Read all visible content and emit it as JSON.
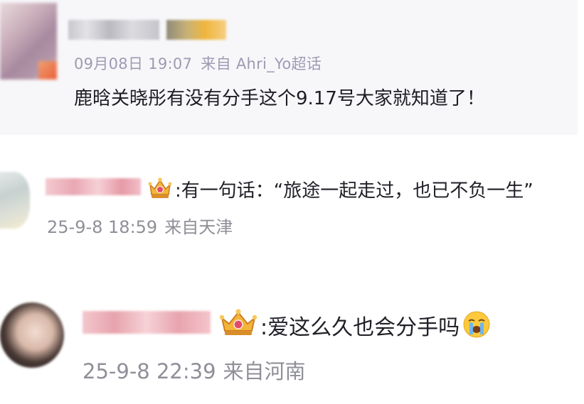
{
  "post": {
    "date": "09月08日",
    "time": "19:07",
    "source": "来自 Ahri_Yo超话",
    "content": "鹿晗关晓彤有没有分手这个9.17号大家就知道了！"
  },
  "comments": [
    {
      "text": ":有一句话：“旅途一起走过，也已不负一生”",
      "timestamp": "25-9-8 18:59",
      "location": "来自天津",
      "icon": "crown-badge-icon"
    },
    {
      "text": ":爱这么久也会分手吗",
      "emoji": "crying-face-icon",
      "timestamp": "25-9-8 22:39",
      "location": "来自河南",
      "icon": "crown-badge-icon"
    }
  ],
  "colors": {
    "meta_text": "#9e9ab2",
    "body_text": "#1c1c24",
    "post_bg": "#f7f7fa"
  }
}
